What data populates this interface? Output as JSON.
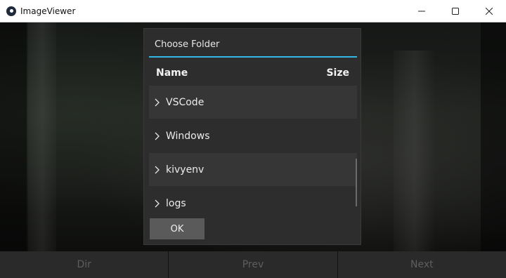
{
  "window": {
    "title": "ImageViewer",
    "icon": "kivy-app-icon",
    "controls": [
      "minimize-icon",
      "maximize-icon",
      "close-icon"
    ]
  },
  "dialog": {
    "title": "Choose Folder",
    "accent_color": "#33b5e5",
    "columns": {
      "name": "Name",
      "size": "Size"
    },
    "items": [
      {
        "label": "VSCode",
        "icon": "chevron-right-icon"
      },
      {
        "label": "Windows",
        "icon": "chevron-right-icon"
      },
      {
        "label": "kivyenv",
        "icon": "chevron-right-icon"
      },
      {
        "label": "logs",
        "icon": "chevron-right-icon"
      }
    ],
    "ok_label": "OK"
  },
  "toolbar": {
    "dir_label": "Dir",
    "prev_label": "Prev",
    "next_label": "Next"
  }
}
